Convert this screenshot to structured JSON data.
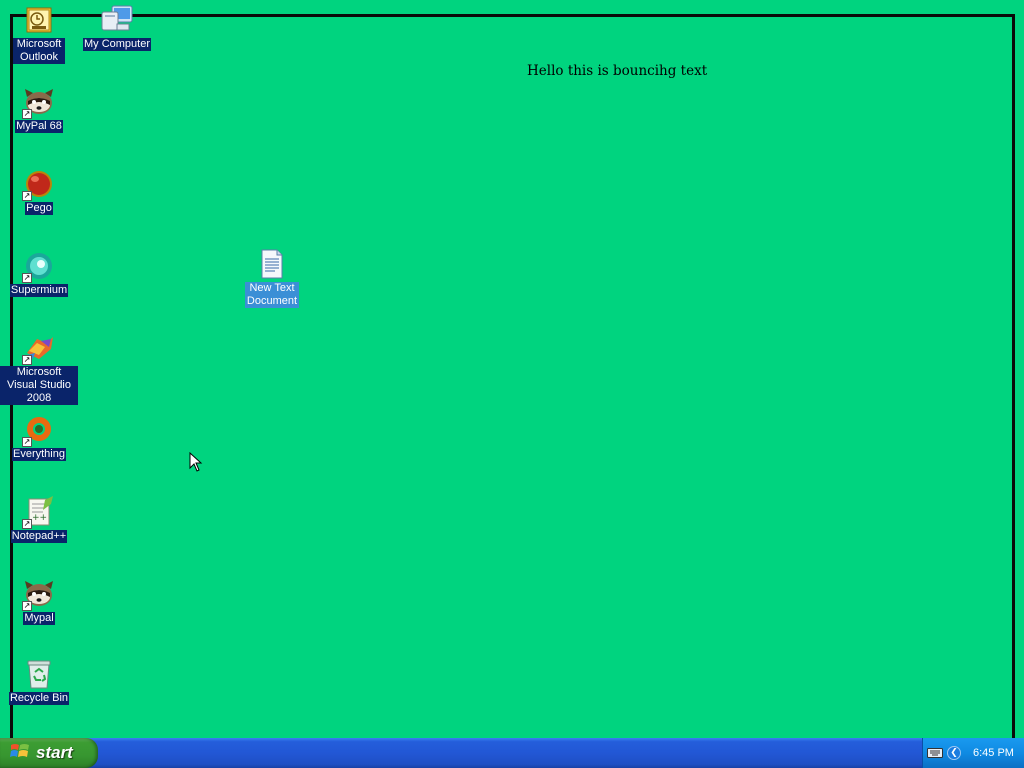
{
  "desktop": {
    "background_color": "#00d47f",
    "bounce_text": "Hello this is bouncihg text",
    "icons": [
      {
        "label": "Microsoft Outlook",
        "icon": "outlook-icon",
        "shortcut": false
      },
      {
        "label": "My Computer",
        "icon": "my-computer-icon",
        "shortcut": false
      },
      {
        "label": "MyPal 68",
        "icon": "mypal-icon",
        "shortcut": true
      },
      {
        "label": "Pego",
        "icon": "pego-icon",
        "shortcut": true
      },
      {
        "label": "Supermium",
        "icon": "supermium-icon",
        "shortcut": true
      },
      {
        "label": "Microsoft Visual Studio 2008",
        "icon": "visual-studio-icon",
        "shortcut": true
      },
      {
        "label": "Everything",
        "icon": "everything-icon",
        "shortcut": true
      },
      {
        "label": "Notepad++",
        "icon": "notepadpp-icon",
        "shortcut": true
      },
      {
        "label": "Mypal",
        "icon": "mypal-icon",
        "shortcut": true
      },
      {
        "label": "Recycle Bin",
        "icon": "recycle-bin-icon",
        "shortcut": false
      },
      {
        "label": "New Text Document",
        "icon": "text-document-icon",
        "shortcut": false
      }
    ]
  },
  "taskbar": {
    "start_label": "start",
    "clock": "6:45 PM",
    "accent_color": "#245edb",
    "start_color": "#3c9d33",
    "tray_color": "#0f8be3"
  }
}
